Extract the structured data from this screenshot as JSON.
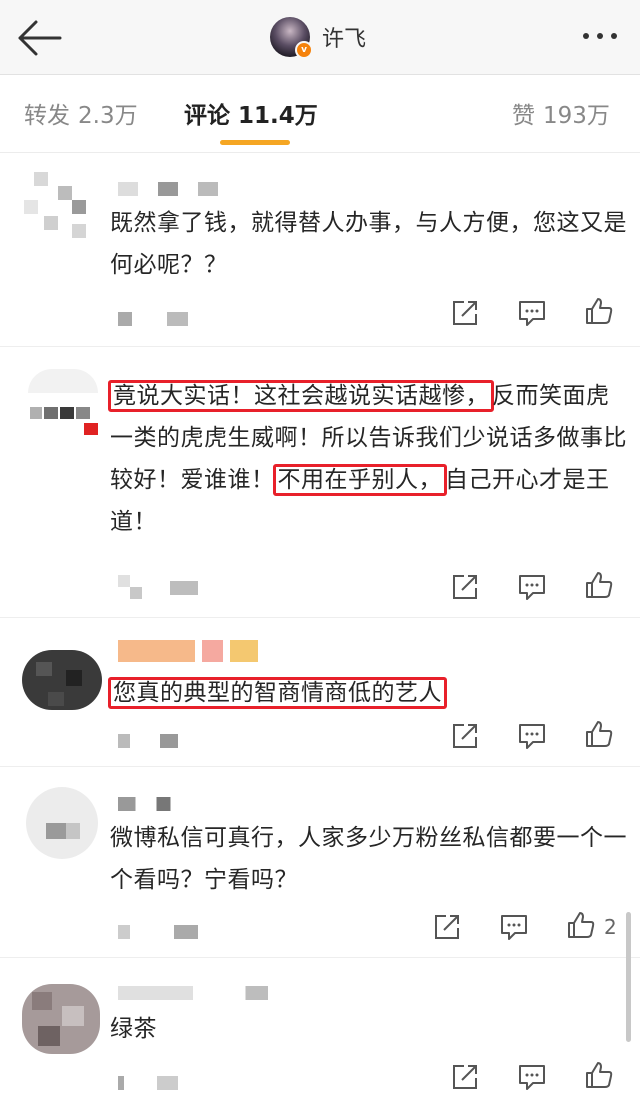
{
  "header": {
    "title": "许飞",
    "verified_badge": "v"
  },
  "tabs": [
    {
      "label": "转发",
      "count": "2.3万"
    },
    {
      "label": "评论",
      "count": "11.4万"
    },
    {
      "label": "赞",
      "count": "193万"
    }
  ],
  "comments": [
    {
      "text": "既然拿了钱，就得替人办事，与人方便，您这又是何必呢？？",
      "likes": ""
    },
    {
      "text_parts": [
        "竟说大实话！这社会越说实话越惨，",
        "反而笑面虎一类的虎虎生威啊！所以告诉我们少说话多做事比较好！爱谁谁！",
        "不用在乎别人，",
        "自己开心才是王道！"
      ],
      "likes": ""
    },
    {
      "text": "您真的典型的智商情商低的艺人",
      "likes": ""
    },
    {
      "text": "微博私信可真行，人家多少万粉丝私信都要一个一个看吗？宁看吗？",
      "likes": "2"
    },
    {
      "text": "绿茶",
      "likes": ""
    }
  ],
  "colors": {
    "accent_underline": "#f5a623",
    "highlight_box": "#e8202a",
    "verified_badge": "#f5820c"
  },
  "icons": [
    "back-arrow-icon",
    "more-icon",
    "repost-icon",
    "comment-icon",
    "like-icon"
  ]
}
